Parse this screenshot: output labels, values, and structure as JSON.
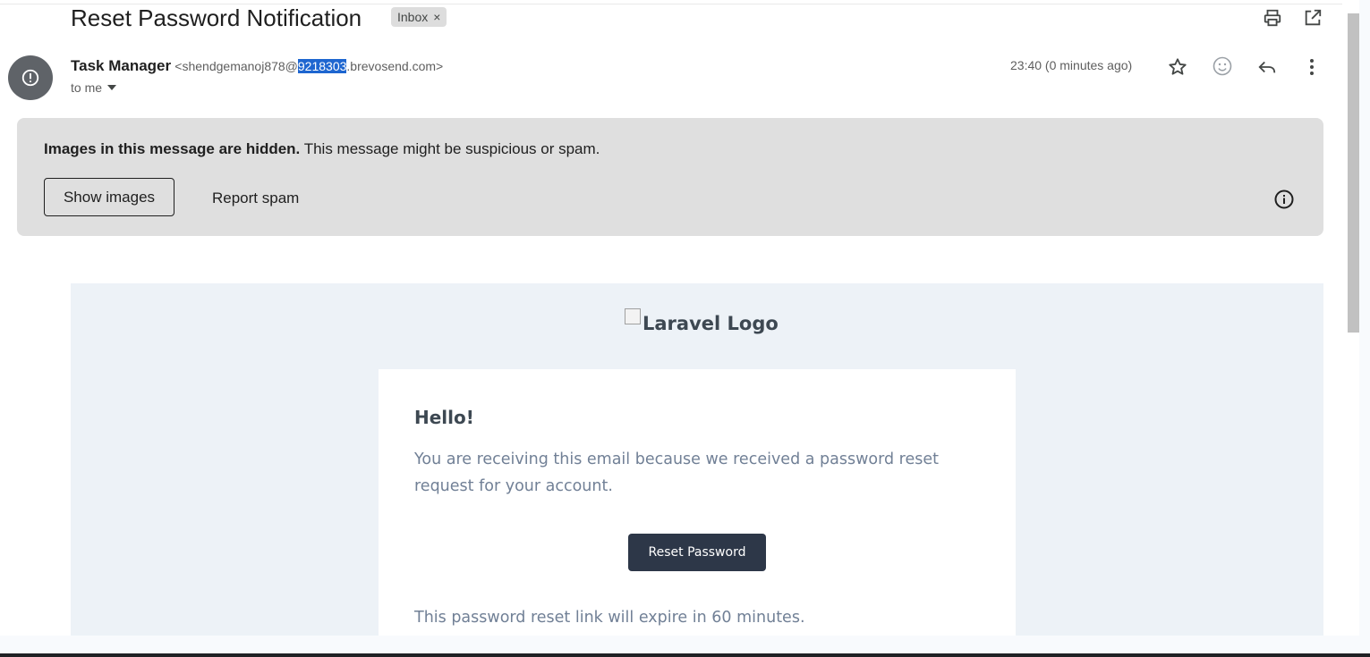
{
  "email": {
    "subject": "Reset Password Notification",
    "label": "Inbox",
    "label_remove": "×",
    "sender_name": "Task Manager",
    "sender_email_prefix": "<shendgemanoj878@",
    "sender_email_selected": "9218303",
    "sender_email_suffix": ".brevosend.com>",
    "to_me": "to me",
    "timestamp": "23:40 (0 minutes ago)"
  },
  "warning": {
    "bold_text": "Images in this message are hidden.",
    "text": " This message might be suspicious or spam.",
    "show_images": "Show images",
    "report_spam": "Report spam"
  },
  "message": {
    "logo_alt": "Laravel Logo",
    "greeting": "Hello!",
    "paragraph": "You are receiving this email because we received a password reset request for your account.",
    "button": "Reset Password",
    "expire_text": "This password reset link will expire in 60 minutes."
  },
  "icons": [
    "print-icon",
    "open-in-new-window-icon",
    "alert-icon",
    "star-icon",
    "emoji-icon",
    "reply-icon",
    "more-vert-icon",
    "dropdown-arrow-icon",
    "info-icon"
  ],
  "colors": {
    "selection": "#1e66d0",
    "button": "#2d3748",
    "body_bg": "#edf2f7",
    "warning_bg": "#dfdfdf"
  }
}
